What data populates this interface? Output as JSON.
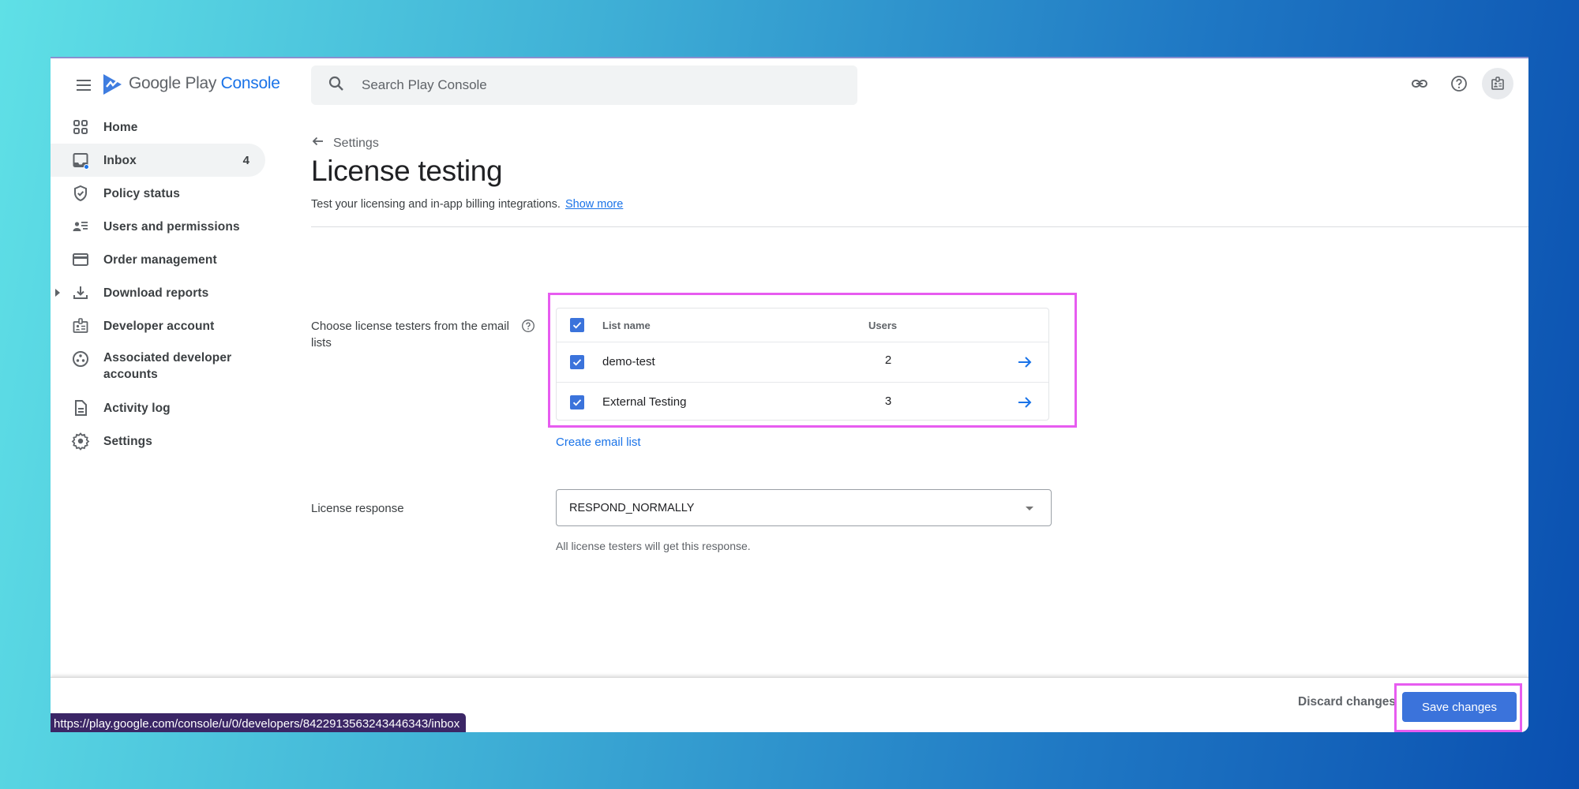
{
  "app": {
    "brand_name": "Google Play",
    "brand_product": "Console",
    "brand_color": "#1a73e8"
  },
  "topbar": {
    "search_placeholder": "Search Play Console",
    "icons": [
      "link-icon",
      "help-icon",
      "account-avatar-icon"
    ]
  },
  "sidebar": {
    "items": [
      {
        "label": "Home",
        "icon": "home-grid-icon"
      },
      {
        "label": "Inbox",
        "icon": "inbox-icon",
        "count": "4",
        "active": true
      },
      {
        "label": "Policy status",
        "icon": "shield-check-icon"
      },
      {
        "label": "Users and permissions",
        "icon": "users-list-icon"
      },
      {
        "label": "Order management",
        "icon": "credit-card-icon"
      },
      {
        "label": "Download reports",
        "icon": "download-icon",
        "expandable": true
      },
      {
        "label": "Developer account",
        "icon": "id-badge-icon"
      },
      {
        "label": "Associated developer accounts",
        "icon": "linked-accounts-icon"
      },
      {
        "label": "Activity log",
        "icon": "document-icon"
      },
      {
        "label": "Settings",
        "icon": "gear-icon"
      }
    ]
  },
  "page": {
    "breadcrumb": "Settings",
    "title": "License testing",
    "description": "Test your licensing and in-app billing integrations.",
    "show_more": "Show more"
  },
  "testers": {
    "label": "Choose license testers from the email lists",
    "columns": [
      "List name",
      "Users"
    ],
    "header_checked": true,
    "rows": [
      {
        "name": "demo-test",
        "users": "2",
        "checked": true
      },
      {
        "name": "External Testing",
        "users": "3",
        "checked": true
      }
    ],
    "create_link": "Create email list"
  },
  "license_response": {
    "label": "License response",
    "selected": "RESPOND_NORMALLY",
    "helper": "All license testers will get this response."
  },
  "footer": {
    "discard_label": "Discard changes",
    "save_label": "Save changes"
  },
  "status_url": "https://play.google.com/console/u/0/developers/8422913563243446343/inbox",
  "colors": {
    "accent": "#1a73e8",
    "checkbox": "#3b73db",
    "highlight_box": "#e75cf0",
    "tooltip_bg": "#3b2666"
  }
}
